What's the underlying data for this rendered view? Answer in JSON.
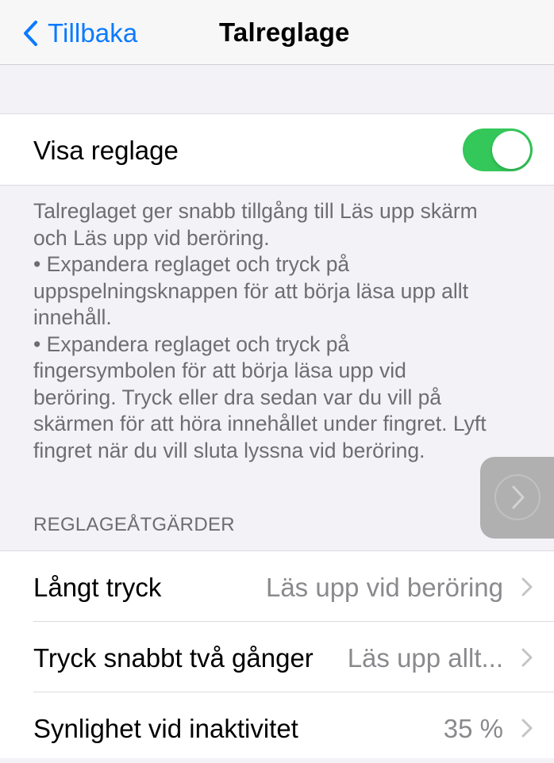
{
  "navbar": {
    "back_label": "Tillbaka",
    "title": "Talreglage"
  },
  "controller": {
    "show_label": "Visa reglage",
    "show_on": true
  },
  "description": {
    "lines": [
      "Talreglaget ger snabb tillgång till Läs upp skärm",
      "och Läs upp vid beröring.",
      " • Expandera reglaget och tryck på",
      "uppspelningsknappen för att börja läsa upp allt",
      "innehåll.",
      " • Expandera reglaget och tryck på",
      "fingersymbolen för att börja läsa upp vid",
      "beröring. Tryck eller dra sedan var du vill på",
      "skärmen för att höra innehållet under fingret. Lyft",
      "fingret när du vill sluta lyssna vid beröring."
    ]
  },
  "actions": {
    "header": "REGLAGEÅTGÄRDER",
    "rows": [
      {
        "label": "Långt tryck",
        "value": "Läs upp vid beröring"
      },
      {
        "label": "Tryck snabbt två gånger",
        "value": "Läs upp allt..."
      },
      {
        "label": "Synlighet vid inaktivitet",
        "value": "35 %"
      }
    ]
  },
  "colors": {
    "accent": "#0a7aff",
    "toggle_on": "#34c759",
    "background": "#f2f2f7",
    "secondary_text": "#6d6d72"
  },
  "icons": {
    "back": "chevron-left-icon",
    "row_disclosure": "chevron-right-icon",
    "floating_controller": "chevron-right-icon"
  }
}
